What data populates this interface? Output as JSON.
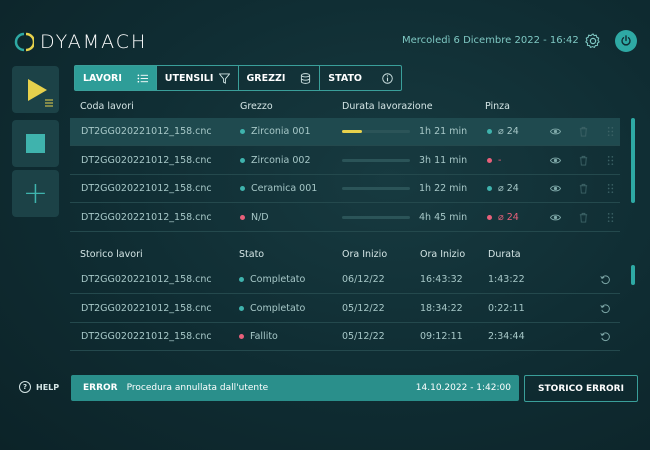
{
  "header": {
    "brand": "DYAMACH",
    "datetime": "Mercoledì 6 Dicembre 2022 - 16:42"
  },
  "tabs": [
    {
      "label": "LAVORI",
      "active": true,
      "icon": "list-icon"
    },
    {
      "label": "UTENSILI",
      "active": false,
      "icon": "funnel-icon"
    },
    {
      "label": "GREZZI",
      "active": false,
      "icon": "database-icon"
    },
    {
      "label": "STATO",
      "active": false,
      "icon": "info-icon"
    }
  ],
  "queue": {
    "headers": [
      "Coda lavori",
      "Grezzo",
      "Durata lavorazione",
      "Pinza"
    ],
    "rows": [
      {
        "file": "DT2GG020221012_158.cnc",
        "grezzo": "Zirconia 001",
        "grezzo_color": "#3fb3ad",
        "progress": 0.3,
        "duration": "1h 21 min",
        "pinza": "⌀ 24",
        "pinza_color": "#3fb3ad",
        "highlight": true
      },
      {
        "file": "DT2GG020221012_158.cnc",
        "grezzo": "Zirconia 002",
        "grezzo_color": "#3fb3ad",
        "progress": 0,
        "duration": "3h 11 min",
        "pinza": "-",
        "pinza_color": "#e8607a",
        "highlight": false
      },
      {
        "file": "DT2GG020221012_158.cnc",
        "grezzo": "Ceramica 001",
        "grezzo_color": "#3fb3ad",
        "progress": 0,
        "duration": "1h 22 min",
        "pinza": "⌀ 24",
        "pinza_color": "#3fb3ad",
        "highlight": false
      },
      {
        "file": "DT2GG020221012_158.cnc",
        "grezzo": "N/D",
        "grezzo_color": "#e8607a",
        "progress": 0,
        "duration": "4h 45 min",
        "pinza": "⌀ 24",
        "pinza_color": "#e8607a",
        "highlight": false
      }
    ]
  },
  "history": {
    "headers": [
      "Storico lavori",
      "Stato",
      "Ora Inizio",
      "Ora Inizio",
      "Durata"
    ],
    "rows": [
      {
        "file": "DT2GG020221012_158.cnc",
        "stato": "Completato",
        "stato_color": "#3fb3ad",
        "date": "06/12/22",
        "time": "16:43:32",
        "duration": "1:43:22"
      },
      {
        "file": "DT2GG020221012_158.cnc",
        "stato": "Completato",
        "stato_color": "#3fb3ad",
        "date": "05/12/22",
        "time": "18:34:22",
        "duration": "0:22:11"
      },
      {
        "file": "DT2GG020221012_158.cnc",
        "stato": "Fallito",
        "stato_color": "#e8607a",
        "date": "05/12/22",
        "time": "09:12:11",
        "duration": "2:34:44"
      }
    ]
  },
  "footer": {
    "help": "HELP",
    "error_type": "ERROR",
    "error_message": "Procedura annullata dall'utente",
    "error_time": "14.10.2022 - 1:42:00",
    "errors_button": "STORICO ERRORI"
  },
  "colors": {
    "accent": "#2ea9a4",
    "warning": "#e7d14c",
    "error": "#e8607a"
  }
}
